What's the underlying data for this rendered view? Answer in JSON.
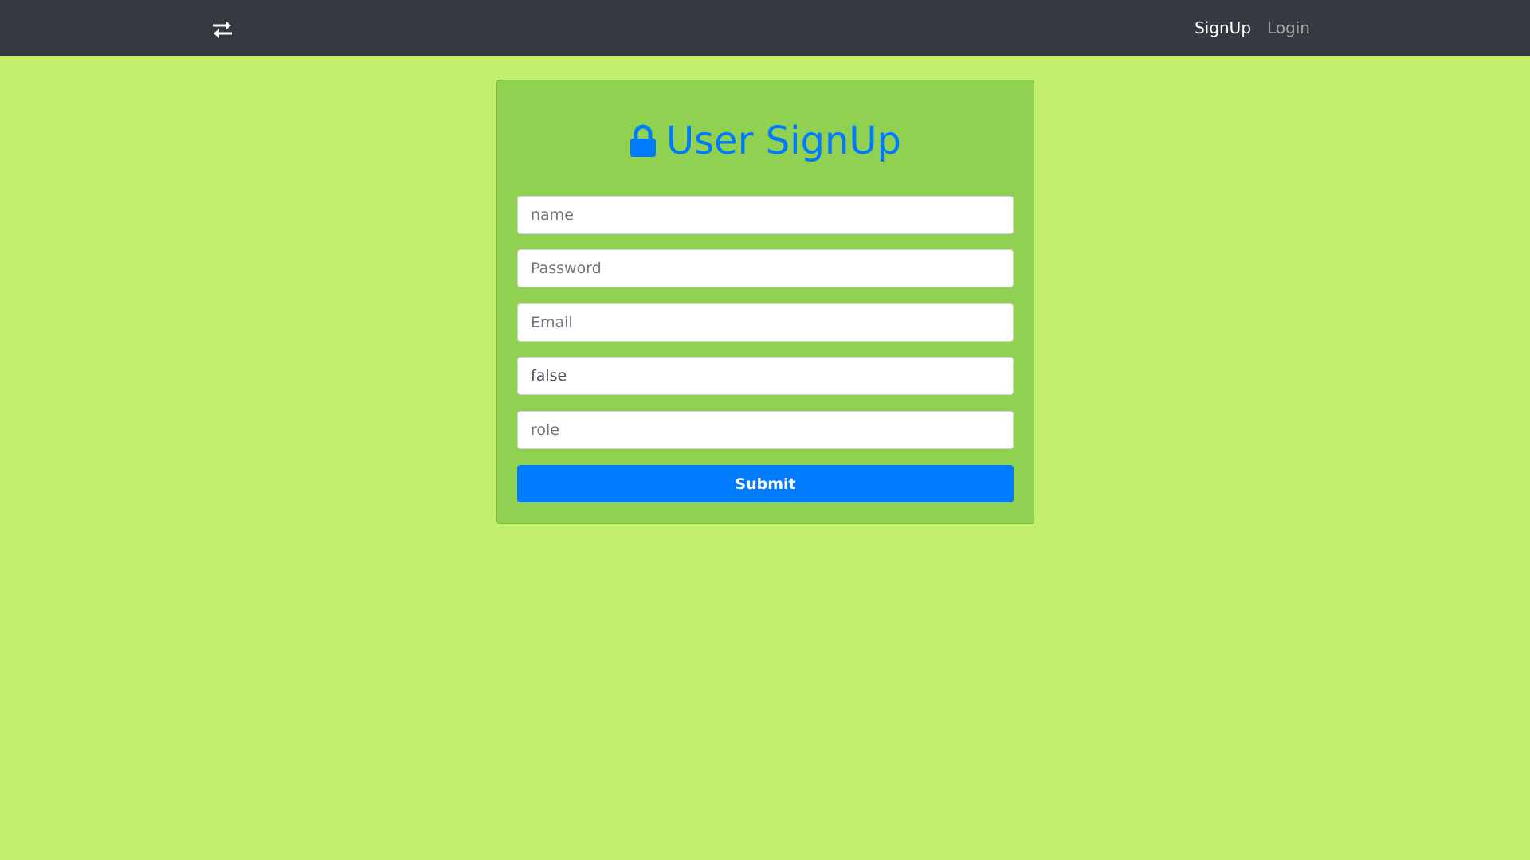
{
  "navbar": {
    "brand_icon": "swap-arrows-icon",
    "links": [
      {
        "label": "SignUp",
        "active": true
      },
      {
        "label": "Login",
        "active": false
      }
    ]
  },
  "form": {
    "title": "User SignUp",
    "title_icon": "lock-icon",
    "fields": {
      "name": {
        "placeholder": "name",
        "value": ""
      },
      "password": {
        "placeholder": "Password",
        "value": ""
      },
      "email": {
        "placeholder": "Email",
        "value": ""
      },
      "flag": {
        "placeholder": "",
        "value": "false"
      },
      "role": {
        "placeholder": "role",
        "value": ""
      }
    },
    "submit_label": "Submit"
  },
  "colors": {
    "page_background": "#c1ef6d",
    "card_background": "#90d152",
    "navbar_background": "#343a40",
    "accent": "#007bff"
  }
}
